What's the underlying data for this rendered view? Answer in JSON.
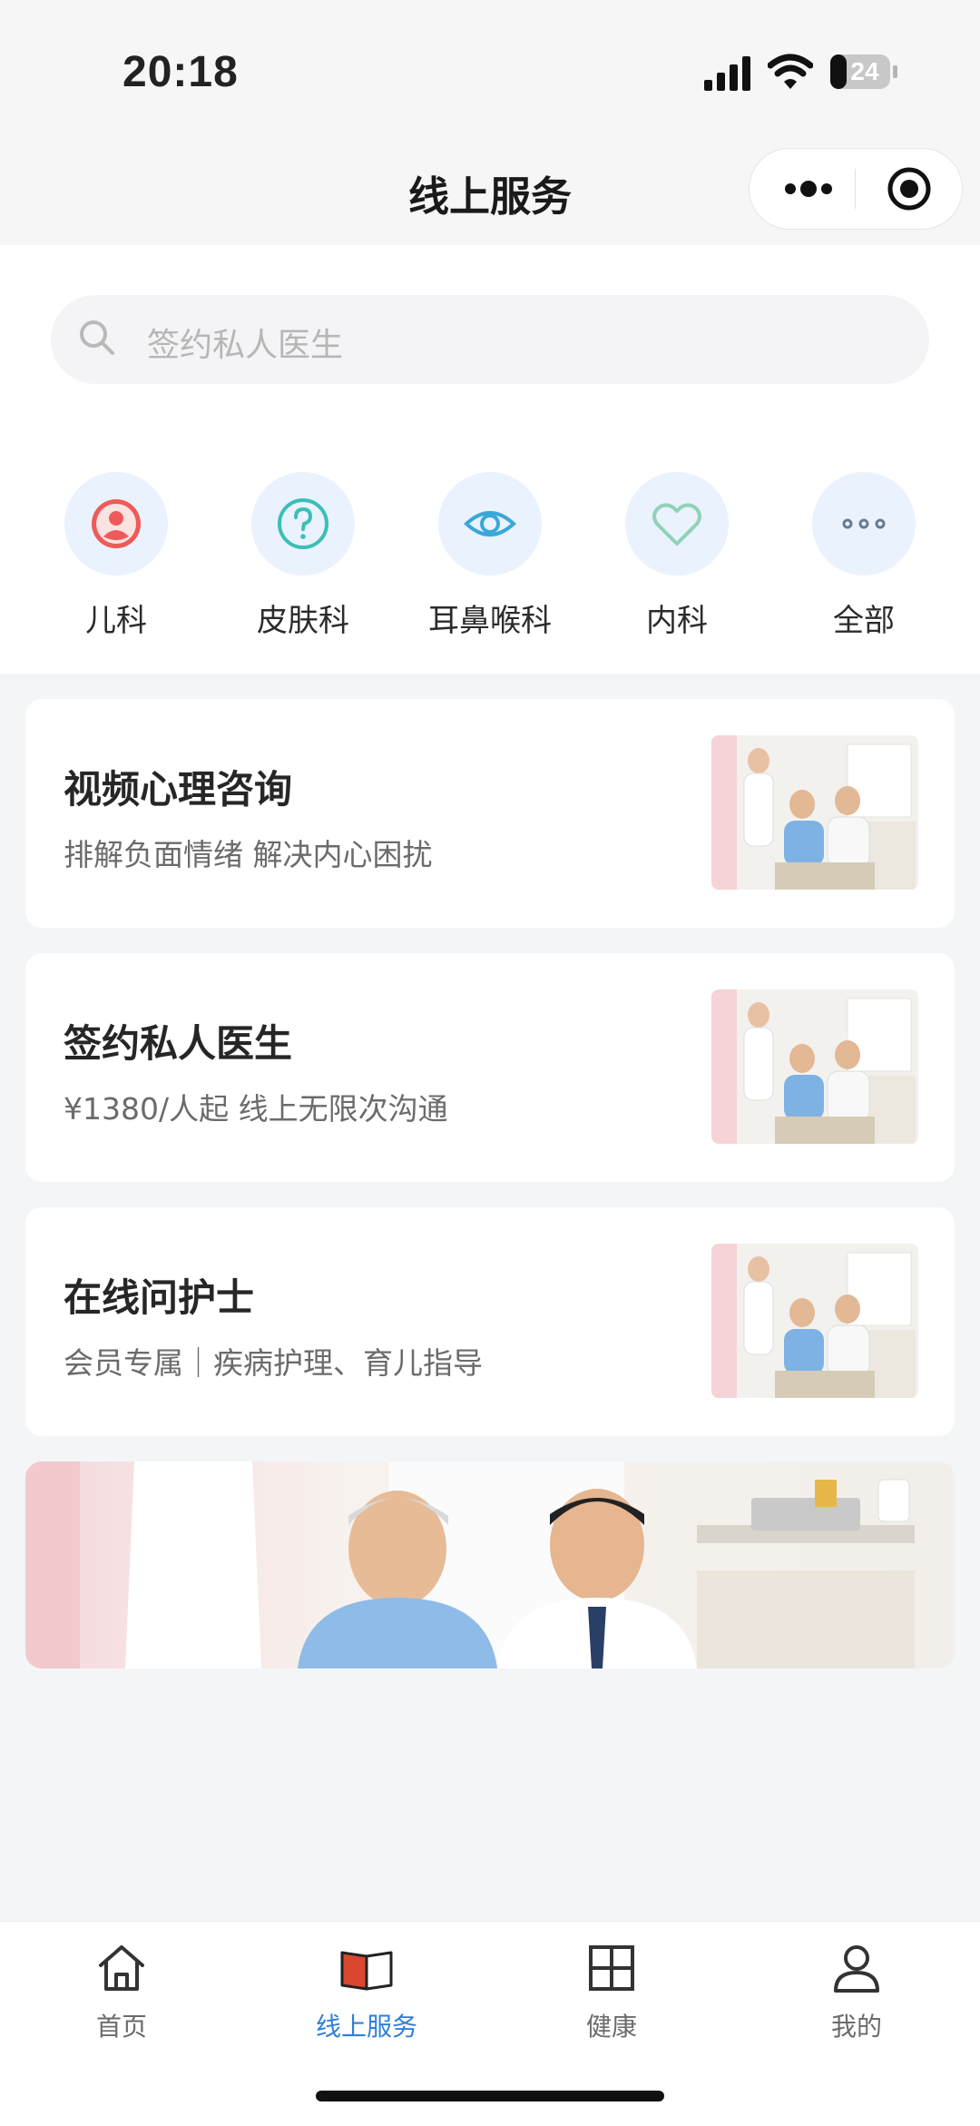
{
  "status_bar": {
    "time": "20:18",
    "battery": "24"
  },
  "nav": {
    "title": "线上服务",
    "more_icon": "more-dots-icon",
    "close_icon": "target-icon"
  },
  "search": {
    "placeholder": "签约私人医生"
  },
  "categories": [
    {
      "label": "儿科",
      "icon": "person-icon",
      "color": "#ee5a5a"
    },
    {
      "label": "皮肤科",
      "icon": "question-icon",
      "color": "#3bbfb4"
    },
    {
      "label": "耳鼻喉科",
      "icon": "eye-icon",
      "color": "#3aa7d9"
    },
    {
      "label": "内科",
      "icon": "heart-icon",
      "color": "#8fd3b6"
    },
    {
      "label": "全部",
      "icon": "more-icon",
      "color": "#6b7a90"
    }
  ],
  "services": [
    {
      "title": "视频心理咨询",
      "subtitle": "排解负面情绪 解决内心困扰"
    },
    {
      "title": "签约私人医生",
      "subtitle": "¥1380/人起 线上无限次沟通"
    },
    {
      "title": "在线问护士",
      "subtitle": "会员专属｜疾病护理、育儿指导"
    }
  ],
  "tabbar": [
    {
      "label": "首页",
      "icon": "home-icon",
      "active": false
    },
    {
      "label": "线上服务",
      "icon": "book-icon",
      "active": true
    },
    {
      "label": "健康",
      "icon": "grid-icon",
      "active": false
    },
    {
      "label": "我的",
      "icon": "user-icon",
      "active": false
    }
  ],
  "colors": {
    "accent": "#2f7fd8",
    "book_red": "#d9472f",
    "icon_bg": "#eaf2fd"
  }
}
